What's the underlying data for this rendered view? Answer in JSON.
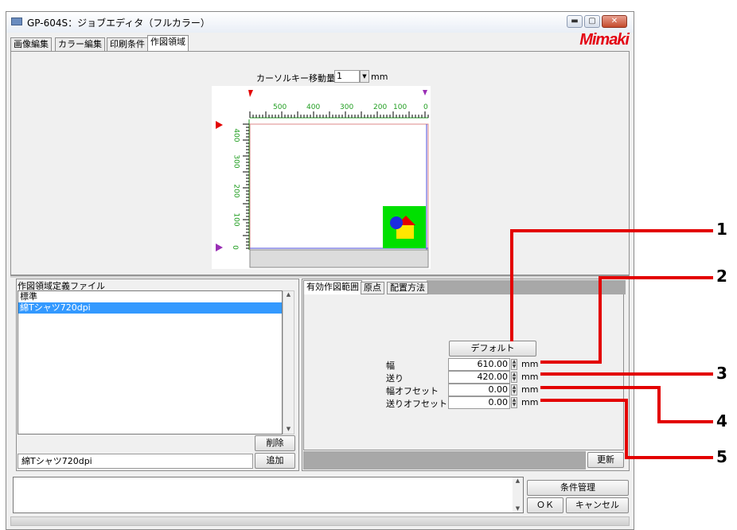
{
  "window": {
    "title": "GP-604S：ジョブエディタ（フルカラー）",
    "brand": "Mimaki",
    "controls": [
      "minimize-icon",
      "maximize-icon",
      "close-icon"
    ]
  },
  "tabs": [
    {
      "label": "画像編集",
      "active": false
    },
    {
      "label": "カラー編集",
      "active": false
    },
    {
      "label": "印刷条件",
      "active": false
    },
    {
      "label": "作図領域",
      "active": true
    }
  ],
  "preview": {
    "cursor_label": "カーソルキー移動量",
    "cursor_value": "1",
    "cursor_unit": "mm",
    "x_ticks": [
      "500",
      "400",
      "300",
      "200",
      "100",
      "0"
    ],
    "y_ticks": [
      "400",
      "300",
      "200",
      "100",
      "0"
    ]
  },
  "definition": {
    "label": "作図領域定義ファイル",
    "items": [
      {
        "label": "標準",
        "selected": false
      },
      {
        "label": "綿Tシャツ720dpi",
        "selected": true
      }
    ],
    "delete_label": "削除",
    "name_value": "綿Tシャツ720dpi",
    "add_label": "追加"
  },
  "settings": {
    "tabs": [
      {
        "label": "有効作図範囲",
        "active": true
      },
      {
        "label": "原点",
        "active": false
      },
      {
        "label": "配置方法",
        "active": false
      }
    ],
    "default_label": "デフォルト",
    "fields": [
      {
        "label": "幅",
        "value": "610.00",
        "unit": "mm"
      },
      {
        "label": "送り",
        "value": "420.00",
        "unit": "mm"
      },
      {
        "label": "幅オフセット",
        "value": "0.00",
        "unit": "mm"
      },
      {
        "label": "送りオフセット",
        "value": "0.00",
        "unit": "mm"
      }
    ],
    "update_label": "更新"
  },
  "footer": {
    "condition_label": "条件管理",
    "ok_label": "ＯＫ",
    "cancel_label": "キャンセル"
  },
  "callouts": [
    "1",
    "2",
    "3",
    "4",
    "5"
  ],
  "colors": {
    "accent_red": "#e30000",
    "ruler_green": "#1f9d1f",
    "selection": "#3399ff",
    "thumb_green": "#00e000"
  }
}
